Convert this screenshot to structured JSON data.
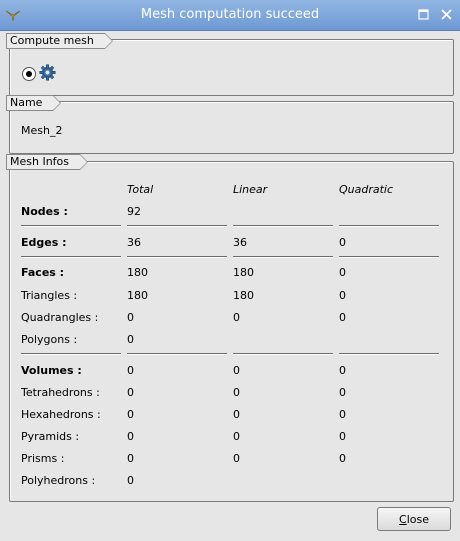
{
  "window": {
    "title": "Mesh computation succeed"
  },
  "icons": {
    "app": "app-logo-icon",
    "maximize": "maximize-icon",
    "close": "close-icon",
    "compute": "gear-icon"
  },
  "compute_mesh": {
    "label": "Compute mesh"
  },
  "name_group": {
    "label": "Name",
    "value": "Mesh_2"
  },
  "mesh_infos": {
    "label": "Mesh Infos",
    "headers": {
      "total": "Total",
      "linear": "Linear",
      "quadratic": "Quadratic"
    },
    "rows": {
      "nodes": {
        "label": "Nodes :",
        "total": "92"
      },
      "edges": {
        "label": "Edges :",
        "total": "36",
        "linear": "36",
        "quadratic": "0"
      },
      "faces": {
        "label": "Faces :",
        "total": "180",
        "linear": "180",
        "quadratic": "0"
      },
      "triangles": {
        "label": "Triangles :",
        "total": "180",
        "linear": "180",
        "quadratic": "0"
      },
      "quadrangles": {
        "label": "Quadrangles :",
        "total": "0",
        "linear": "0",
        "quadratic": "0"
      },
      "polygons": {
        "label": "Polygons :",
        "total": "0"
      },
      "volumes": {
        "label": "Volumes :",
        "total": "0",
        "linear": "0",
        "quadratic": "0"
      },
      "tetrahedrons": {
        "label": "Tetrahedrons :",
        "total": "0",
        "linear": "0",
        "quadratic": "0"
      },
      "hexahedrons": {
        "label": "Hexahedrons :",
        "total": "0",
        "linear": "0",
        "quadratic": "0"
      },
      "pyramids": {
        "label": "Pyramids :",
        "total": "0",
        "linear": "0",
        "quadratic": "0"
      },
      "prisms": {
        "label": "Prisms :",
        "total": "0",
        "linear": "0",
        "quadratic": "0"
      },
      "polyhedrons": {
        "label": "Polyhedrons :",
        "total": "0"
      }
    }
  },
  "buttons": {
    "close_first": "C",
    "close_rest": "lose"
  }
}
